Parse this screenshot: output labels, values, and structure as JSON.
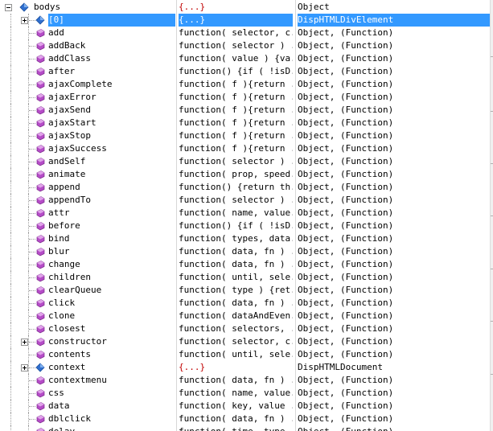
{
  "tree": {
    "root": {
      "name": "bodys",
      "value": "{...}",
      "type": "Object"
    },
    "rows": [
      {
        "name": "[0]",
        "value": "{...}",
        "type": "DispHTMLDivElement",
        "kind": "object",
        "expander": "plus",
        "selected": true
      },
      {
        "name": "add",
        "value": "function( selector, c...",
        "type": "Object, (Function)",
        "kind": "method"
      },
      {
        "name": "addBack",
        "value": "function( selector ) ...",
        "type": "Object, (Function)",
        "kind": "method"
      },
      {
        "name": "addClass",
        "value": "function( value ) {va...",
        "type": "Object, (Function)",
        "kind": "method"
      },
      {
        "name": "after",
        "value": "function() {if ( !isD...",
        "type": "Object, (Function)",
        "kind": "method"
      },
      {
        "name": "ajaxComplete",
        "value": "function( f ){return ...",
        "type": "Object, (Function)",
        "kind": "method"
      },
      {
        "name": "ajaxError",
        "value": "function( f ){return ...",
        "type": "Object, (Function)",
        "kind": "method"
      },
      {
        "name": "ajaxSend",
        "value": "function( f ){return ...",
        "type": "Object, (Function)",
        "kind": "method"
      },
      {
        "name": "ajaxStart",
        "value": "function( f ){return ...",
        "type": "Object, (Function)",
        "kind": "method"
      },
      {
        "name": "ajaxStop",
        "value": "function( f ){return ...",
        "type": "Object, (Function)",
        "kind": "method"
      },
      {
        "name": "ajaxSuccess",
        "value": "function( f ){return ...",
        "type": "Object, (Function)",
        "kind": "method"
      },
      {
        "name": "andSelf",
        "value": "function( selector ) ...",
        "type": "Object, (Function)",
        "kind": "method"
      },
      {
        "name": "animate",
        "value": "function( prop, speed...",
        "type": "Object, (Function)",
        "kind": "method"
      },
      {
        "name": "append",
        "value": "function() {return th...",
        "type": "Object, (Function)",
        "kind": "method"
      },
      {
        "name": "appendTo",
        "value": "function( selector ) ...",
        "type": "Object, (Function)",
        "kind": "method"
      },
      {
        "name": "attr",
        "value": "function( name, value...",
        "type": "Object, (Function)",
        "kind": "method"
      },
      {
        "name": "before",
        "value": "function() {if ( !isD...",
        "type": "Object, (Function)",
        "kind": "method"
      },
      {
        "name": "bind",
        "value": "function( types, data...",
        "type": "Object, (Function)",
        "kind": "method"
      },
      {
        "name": "blur",
        "value": "function( data, fn ) ...",
        "type": "Object, (Function)",
        "kind": "method"
      },
      {
        "name": "change",
        "value": "function( data, fn ) ...",
        "type": "Object, (Function)",
        "kind": "method"
      },
      {
        "name": "children",
        "value": "function( until, sele...",
        "type": "Object, (Function)",
        "kind": "method"
      },
      {
        "name": "clearQueue",
        "value": "function( type ) {ret...",
        "type": "Object, (Function)",
        "kind": "method"
      },
      {
        "name": "click",
        "value": "function( data, fn ) ...",
        "type": "Object, (Function)",
        "kind": "method"
      },
      {
        "name": "clone",
        "value": "function( dataAndEven...",
        "type": "Object, (Function)",
        "kind": "method"
      },
      {
        "name": "closest",
        "value": "function( selectors, ...",
        "type": "Object, (Function)",
        "kind": "method"
      },
      {
        "name": "constructor",
        "value": "function( selector, c...",
        "type": "Object, (Function)",
        "kind": "method",
        "expander": "plus"
      },
      {
        "name": "contents",
        "value": "function( until, sele...",
        "type": "Object, (Function)",
        "kind": "method"
      },
      {
        "name": "context",
        "value": "{...}",
        "type": "DispHTMLDocument",
        "kind": "object",
        "expander": "plus"
      },
      {
        "name": "contextmenu",
        "value": "function( data, fn ) ...",
        "type": "Object, (Function)",
        "kind": "method"
      },
      {
        "name": "css",
        "value": "function( name, value...",
        "type": "Object, (Function)",
        "kind": "method"
      },
      {
        "name": "data",
        "value": "function( key, value ...",
        "type": "Object, (Function)",
        "kind": "method"
      },
      {
        "name": "dblclick",
        "value": "function( data, fn ) ...",
        "type": "Object, (Function)",
        "kind": "method"
      },
      {
        "name": "delay",
        "value": "function( time, type ...",
        "type": "Object, (Function)",
        "kind": "method"
      }
    ]
  },
  "colors": {
    "selection": "#3399ff",
    "object_value": "#c00000",
    "method_icon": "#b54cc7",
    "object_icon": "#2f6fcf"
  }
}
